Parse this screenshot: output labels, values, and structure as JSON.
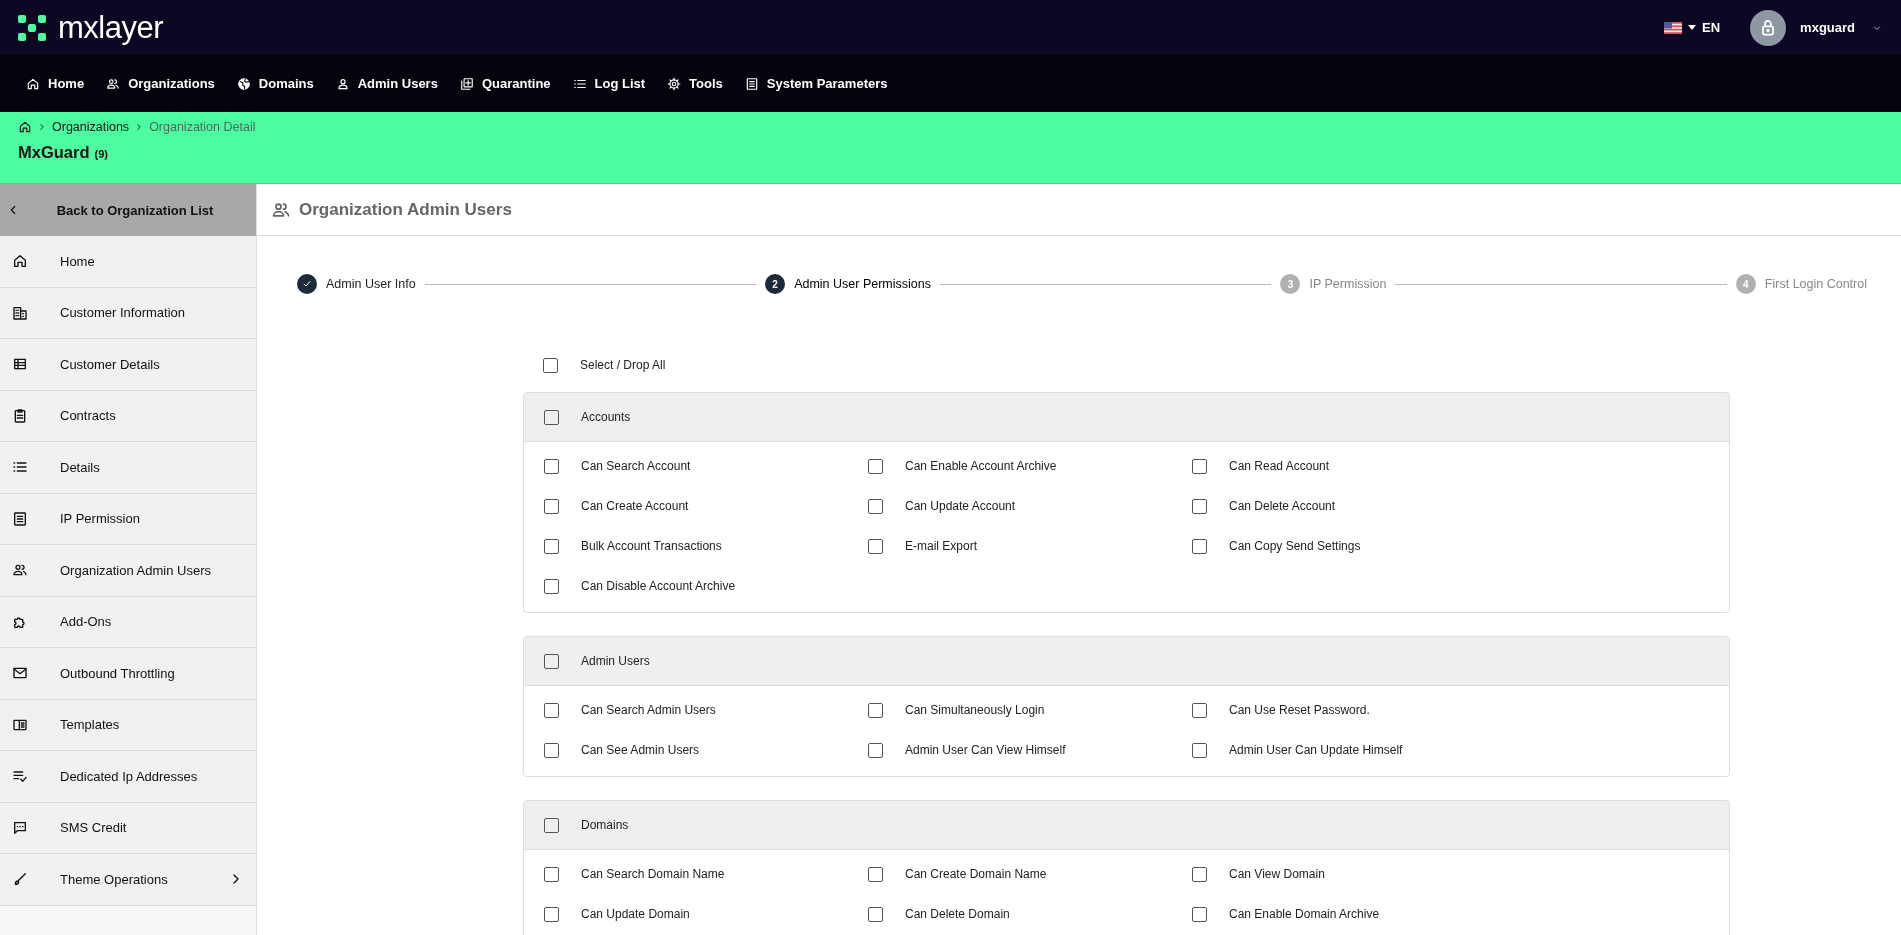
{
  "topbar": {
    "logo": "mxlayer",
    "language": "EN",
    "user": "mxguard"
  },
  "nav": [
    "Home",
    "Organizations",
    "Domains",
    "Admin Users",
    "Quarantine",
    "Log List",
    "Tools",
    "System Parameters"
  ],
  "breadcrumb": [
    "Organizations",
    "Organization Detail"
  ],
  "org": {
    "name": "MxGuard",
    "count": "(9)"
  },
  "sidebar": {
    "back": "Back to Organization List",
    "items": [
      {
        "label": "Home",
        "submenu": false
      },
      {
        "label": "Customer Information",
        "submenu": false
      },
      {
        "label": "Customer Details",
        "submenu": false
      },
      {
        "label": "Contracts",
        "submenu": false
      },
      {
        "label": "Details",
        "submenu": false
      },
      {
        "label": "IP Permission",
        "submenu": false
      },
      {
        "label": "Organization Admin Users",
        "submenu": false
      },
      {
        "label": "Add-Ons",
        "submenu": false
      },
      {
        "label": "Outbound Throttling",
        "submenu": false
      },
      {
        "label": "Templates",
        "submenu": false
      },
      {
        "label": "Dedicated Ip Addresses",
        "submenu": false
      },
      {
        "label": "SMS Credit",
        "submenu": false
      },
      {
        "label": "Theme Operations",
        "submenu": true
      }
    ]
  },
  "section_title": "Organization Admin Users",
  "steps": [
    {
      "label": "Admin User Info",
      "completed": true,
      "selected": false
    },
    {
      "label": "Admin User Permissions",
      "number": "2",
      "completed": false,
      "selected": true
    },
    {
      "label": "IP Permission",
      "number": "3",
      "completed": false,
      "selected": false
    },
    {
      "label": "First Login Control",
      "number": "4",
      "completed": false,
      "selected": false
    }
  ],
  "select_all": {
    "label": "Select / Drop All",
    "checked": false
  },
  "groups": [
    {
      "title": "Accounts",
      "checked": false,
      "permissions": [
        {
          "label": "Can Search Account",
          "checked": false
        },
        {
          "label": "Can Enable Account Archive",
          "checked": false
        },
        {
          "label": "Can Read Account",
          "checked": false
        },
        {
          "label": "Can Create Account",
          "checked": false
        },
        {
          "label": "Can Update Account",
          "checked": false
        },
        {
          "label": "Can Delete Account",
          "checked": false
        },
        {
          "label": "Bulk Account Transactions",
          "checked": false
        },
        {
          "label": "E-mail Export",
          "checked": false
        },
        {
          "label": "Can Copy Send Settings",
          "checked": false
        },
        {
          "label": "Can Disable Account Archive",
          "checked": false
        }
      ]
    },
    {
      "title": "Admin Users",
      "checked": false,
      "permissions": [
        {
          "label": "Can Search Admin Users",
          "checked": false
        },
        {
          "label": "Can Simultaneously Login",
          "checked": false
        },
        {
          "label": "Can Use Reset Password.",
          "checked": false
        },
        {
          "label": "Can See Admin Users",
          "checked": false
        },
        {
          "label": "Admin User Can View Himself",
          "checked": false
        },
        {
          "label": "Admin User Can Update Himself",
          "checked": false
        }
      ]
    },
    {
      "title": "Domains",
      "checked": false,
      "permissions": [
        {
          "label": "Can Search Domain Name",
          "checked": false
        },
        {
          "label": "Can Create Domain Name",
          "checked": false
        },
        {
          "label": "Can View Domain",
          "checked": false
        },
        {
          "label": "Can Update Domain",
          "checked": false
        },
        {
          "label": "Can Delete Domain",
          "checked": false
        },
        {
          "label": "Can Enable Domain Archive",
          "checked": false
        }
      ]
    }
  ]
}
